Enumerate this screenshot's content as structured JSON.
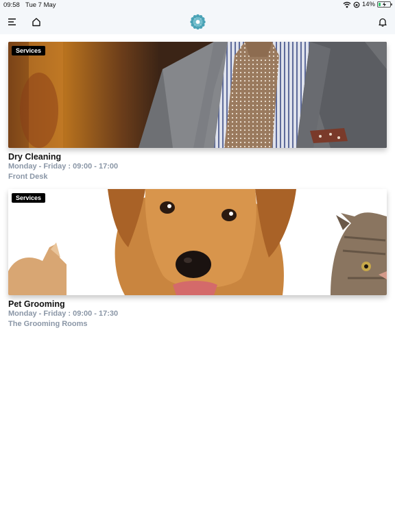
{
  "status_bar": {
    "time": "09:58",
    "date": "Tue 7 May",
    "battery_percent": "14%",
    "battery_level": 0.14
  },
  "header": {
    "menu_icon": "hamburger-menu-icon",
    "home_icon": "home-icon",
    "logo_icon": "flower-logo-icon",
    "bell_icon": "bell-icon",
    "accent_color": "#4aa3b6"
  },
  "cards": [
    {
      "badge": "Services",
      "title": "Dry Cleaning",
      "hours": "Monday - Friday : 09:00 - 17:00",
      "location": "Front Desk",
      "image": "suit-and-tie-photo"
    },
    {
      "badge": "Services",
      "title": "Pet Grooming",
      "hours": "Monday - Friday : 09:00 - 17:30",
      "location": "The Grooming Rooms",
      "image": "puppy-kitten-bunny-photo"
    }
  ]
}
